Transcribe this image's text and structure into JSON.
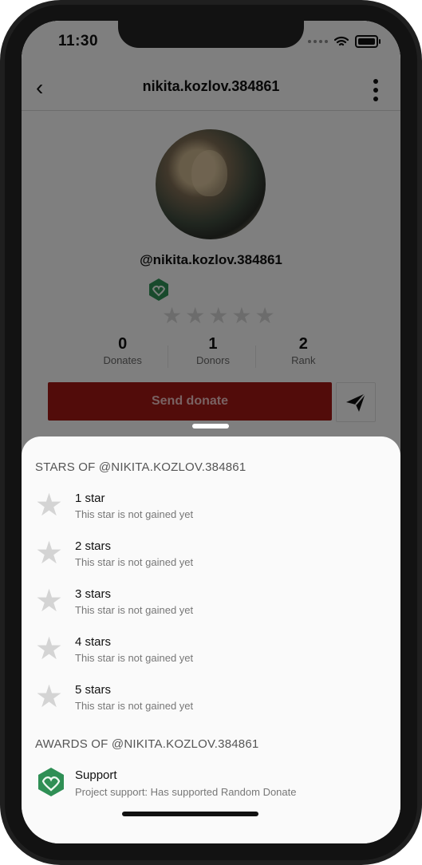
{
  "status_bar": {
    "time": "11:30"
  },
  "header": {
    "back_icon": "‹",
    "title": "nikita.kozlov.384861"
  },
  "profile": {
    "handle": "@nikita.kozlov.384861",
    "stats": [
      {
        "value": "0",
        "label": "Donates"
      },
      {
        "value": "1",
        "label": "Donors"
      },
      {
        "value": "2",
        "label": "Rank"
      }
    ],
    "send_button": "Send donate"
  },
  "sheet": {
    "stars_heading": "STARS OF @NIKITA.KOZLOV.384861",
    "stars": [
      {
        "title": "1 star",
        "subtitle": "This star is not gained yet"
      },
      {
        "title": "2 stars",
        "subtitle": "This star is not gained yet"
      },
      {
        "title": "3 stars",
        "subtitle": "This star is not gained yet"
      },
      {
        "title": "4 stars",
        "subtitle": "This star is not gained yet"
      },
      {
        "title": "5 stars",
        "subtitle": "This star is not gained yet"
      }
    ],
    "awards_heading": "AWARDS OF @NIKITA.KOZLOV.384861",
    "award": {
      "title": "Support",
      "subtitle": "Project support: Has supported Random Donate"
    }
  },
  "colors": {
    "accent": "#9d1715",
    "badge": "#2f8f55"
  }
}
